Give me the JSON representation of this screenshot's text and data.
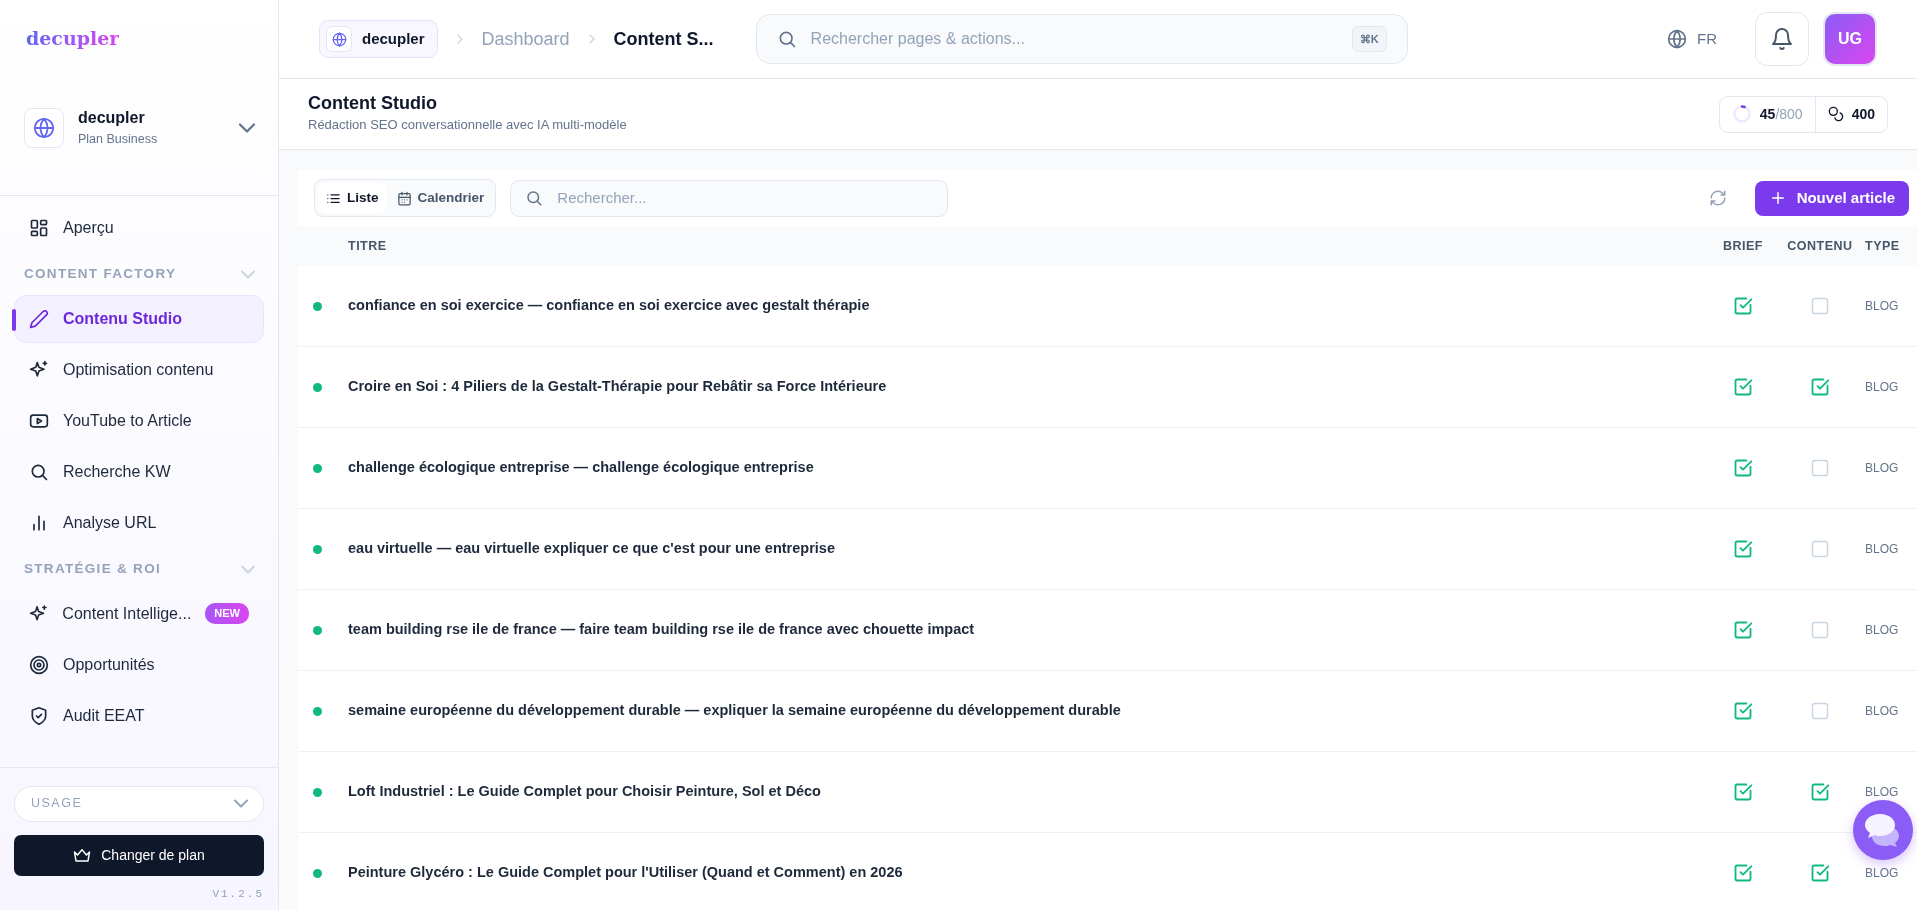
{
  "sidebar": {
    "logo": "decupler",
    "workspace": {
      "name": "decupler",
      "plan": "Plan Business"
    },
    "nav": [
      {
        "kind": "item",
        "label": "Aperçu",
        "selected": false
      },
      {
        "kind": "section",
        "label": "CONTENT FACTORY",
        "expanded": true
      },
      {
        "kind": "item",
        "label": "Contenu Studio",
        "selected": true
      },
      {
        "kind": "item",
        "label": "Optimisation contenu",
        "selected": false
      },
      {
        "kind": "item",
        "label": "YouTube to Article",
        "selected": false
      },
      {
        "kind": "item",
        "label": "Recherche KW",
        "selected": false
      },
      {
        "kind": "item",
        "label": "Analyse URL",
        "selected": false
      },
      {
        "kind": "section",
        "label": "STRATÉGIE & ROI",
        "expanded": true
      },
      {
        "kind": "item",
        "label": "Content Intellige...",
        "selected": false,
        "badge": "NEW"
      },
      {
        "kind": "item",
        "label": "Opportunités",
        "selected": false
      },
      {
        "kind": "item",
        "label": "Audit EEAT",
        "selected": false
      }
    ],
    "usage_dropdown": "USAGE",
    "plan_button": "Changer de plan",
    "version": "V1.2.5"
  },
  "header": {
    "breadcrumb": [
      "decupler",
      "Dashboard",
      "Content S..."
    ],
    "search": {
      "placeholder": "Rechercher pages & actions...",
      "shortcut": "⌘K"
    },
    "language": "FR",
    "avatar": "UG"
  },
  "page": {
    "title": "Content Studio",
    "subtitle": "Rédaction SEO conversationnelle avec IA multi-modèle",
    "usage": {
      "used": "45",
      "limit": "/800",
      "level": 0.056
    },
    "credits": "400"
  },
  "toolbar": {
    "views": [
      {
        "label": "Liste",
        "selected": true
      },
      {
        "label": "Calendrier",
        "selected": false
      }
    ],
    "search": {
      "placeholder": "Rechercher..."
    },
    "new_button": "Nouvel article"
  },
  "table": {
    "columns": [
      "TITRE",
      "BRIEF",
      "CONTENU",
      "TYPE"
    ],
    "rows": [
      {
        "title": "confiance en soi exercice — confiance en soi exercice avec gestalt thérapie",
        "brief": true,
        "contenu": false,
        "type": "BLOG"
      },
      {
        "title": "Croire en Soi : 4 Piliers de la Gestalt-Thérapie pour Rebâtir sa Force Intérieure",
        "brief": true,
        "contenu": true,
        "type": "BLOG"
      },
      {
        "title": "challenge écologique entreprise — challenge écologique entreprise",
        "brief": true,
        "contenu": false,
        "type": "BLOG"
      },
      {
        "title": "eau virtuelle — eau virtuelle expliquer ce que c'est pour une entreprise",
        "brief": true,
        "contenu": false,
        "type": "BLOG"
      },
      {
        "title": "team building rse ile de france — faire team building rse ile de france avec chouette impact",
        "brief": true,
        "contenu": false,
        "type": "BLOG"
      },
      {
        "title": "semaine européenne du développement durable — expliquer la semaine européenne du développement durable",
        "brief": true,
        "contenu": false,
        "type": "BLOG"
      },
      {
        "title": "Loft Industriel : Le Guide Complet pour Choisir Peinture, Sol et Déco",
        "brief": true,
        "contenu": true,
        "type": "BLOG"
      },
      {
        "title": "Peinture Glycéro : Le Guide Complet pour l'Utiliser (Quand et Comment) en 2026",
        "brief": true,
        "contenu": true,
        "type": "BLOG"
      }
    ]
  }
}
